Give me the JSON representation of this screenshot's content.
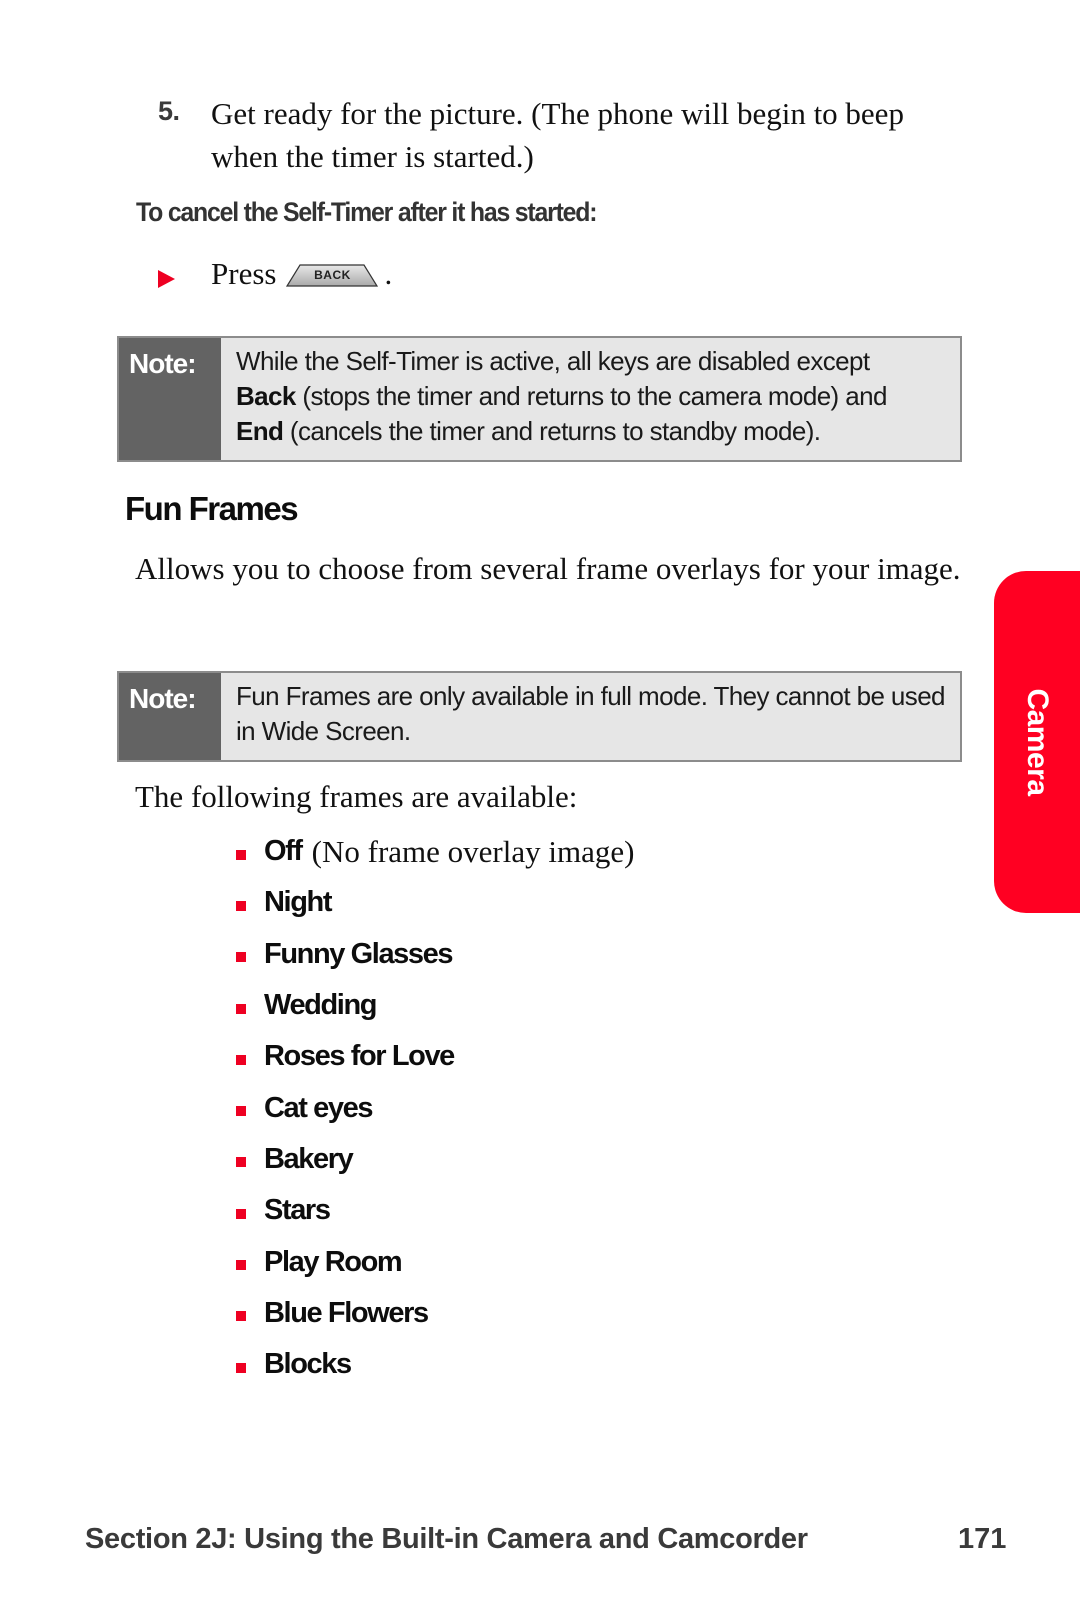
{
  "step": {
    "number": "5.",
    "text": "Get ready for the picture. (The phone will begin to beep when the timer is started.)"
  },
  "cancel_heading": "To cancel the Self-Timer after it has started:",
  "press_instruction": {
    "prefix": "Press",
    "key_label": "BACK",
    "suffix": ".",
    "bullet_icon": "red-triangle-arrow",
    "bullet_color": "#ee0022"
  },
  "note1": {
    "label": "Note:",
    "line1": "While the Self-Timer is active, all keys are disabled except",
    "back_bold": "Back",
    "back_text": " (stops the timer and returns to the camera mode) and",
    "end_bold": "End",
    "end_text": " (cancels the timer and returns to standby mode)."
  },
  "section": {
    "title": "Fun Frames",
    "intro": "Allows you to choose from several frame overlays for your image."
  },
  "note2": {
    "label": "Note:",
    "text": "Fun Frames are only available in full mode. They cannot be used in Wide Screen."
  },
  "available_text": "The following frames are available:",
  "frames": [
    {
      "name": "Off",
      "desc": "(No frame overlay image)"
    },
    {
      "name": "Night",
      "desc": ""
    },
    {
      "name": "Funny Glasses",
      "desc": ""
    },
    {
      "name": "Wedding",
      "desc": ""
    },
    {
      "name": "Roses for Love",
      "desc": ""
    },
    {
      "name": "Cat eyes",
      "desc": ""
    },
    {
      "name": "Bakery",
      "desc": ""
    },
    {
      "name": "Stars",
      "desc": ""
    },
    {
      "name": "Play Room",
      "desc": ""
    },
    {
      "name": "Blue Flowers",
      "desc": ""
    },
    {
      "name": "Blocks",
      "desc": ""
    }
  ],
  "side_tab": {
    "label": "Camera",
    "color": "#ff0022"
  },
  "footer": {
    "section": "Section 2J: Using the Built-in Camera and Camcorder",
    "page": "171"
  }
}
